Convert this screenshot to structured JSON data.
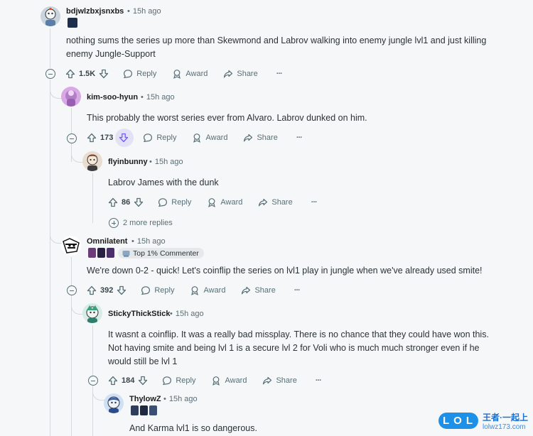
{
  "comments": [
    {
      "username": "bdjwlzbxjsnxbs",
      "time": "15h ago",
      "body": [
        "nothing sums the series up more than Skewmond and Labrov walking into enemy jungle lvl1 and just killing",
        "enemy Jungle-Support"
      ],
      "votes": "1.5K"
    },
    {
      "username": "kim-soo-hyun",
      "time": "15h ago",
      "body": [
        "This probably the worst series ever from Alvaro. Labrov dunked on him."
      ],
      "votes": "173"
    },
    {
      "username": "flyinbunny",
      "time": "15h ago",
      "body": [
        "Labrov James with the dunk"
      ],
      "votes": "86"
    },
    {
      "username": "Omnilatent",
      "time": "15h ago",
      "badge": "Top 1% Commenter",
      "body": [
        "We're down 0-2 - quick! Let's coinflip the series on lvl1 play in jungle when we've already used smite!"
      ],
      "votes": "392"
    },
    {
      "username": "StickyThickStick",
      "time": "15h ago",
      "body": [
        "It wasnt a coinflip. It was a really bad missplay. There is no chance that they could have won this.",
        "Not having smite and being lvl 1 is a secure lvl 2 for Voli who is much much stronger even if he",
        "would still be lvl 1"
      ],
      "votes": "184"
    },
    {
      "username": "ThylowZ",
      "time": "15h ago",
      "body": [
        "And Karma lvl1 is so dangerous."
      ]
    }
  ],
  "actions": {
    "reply": "Reply",
    "award": "Award",
    "share": "Share",
    "more": "···"
  },
  "more_replies": "2 more replies",
  "separator": "•",
  "watermark": {
    "logo": "LOL",
    "cn": "王者·一起上",
    "domain": "lolwz173.com"
  },
  "colors": {
    "accent_downvote": "#6a5cff",
    "thread_line": "#d5d9dc",
    "meta_text": "#5c6c74"
  }
}
